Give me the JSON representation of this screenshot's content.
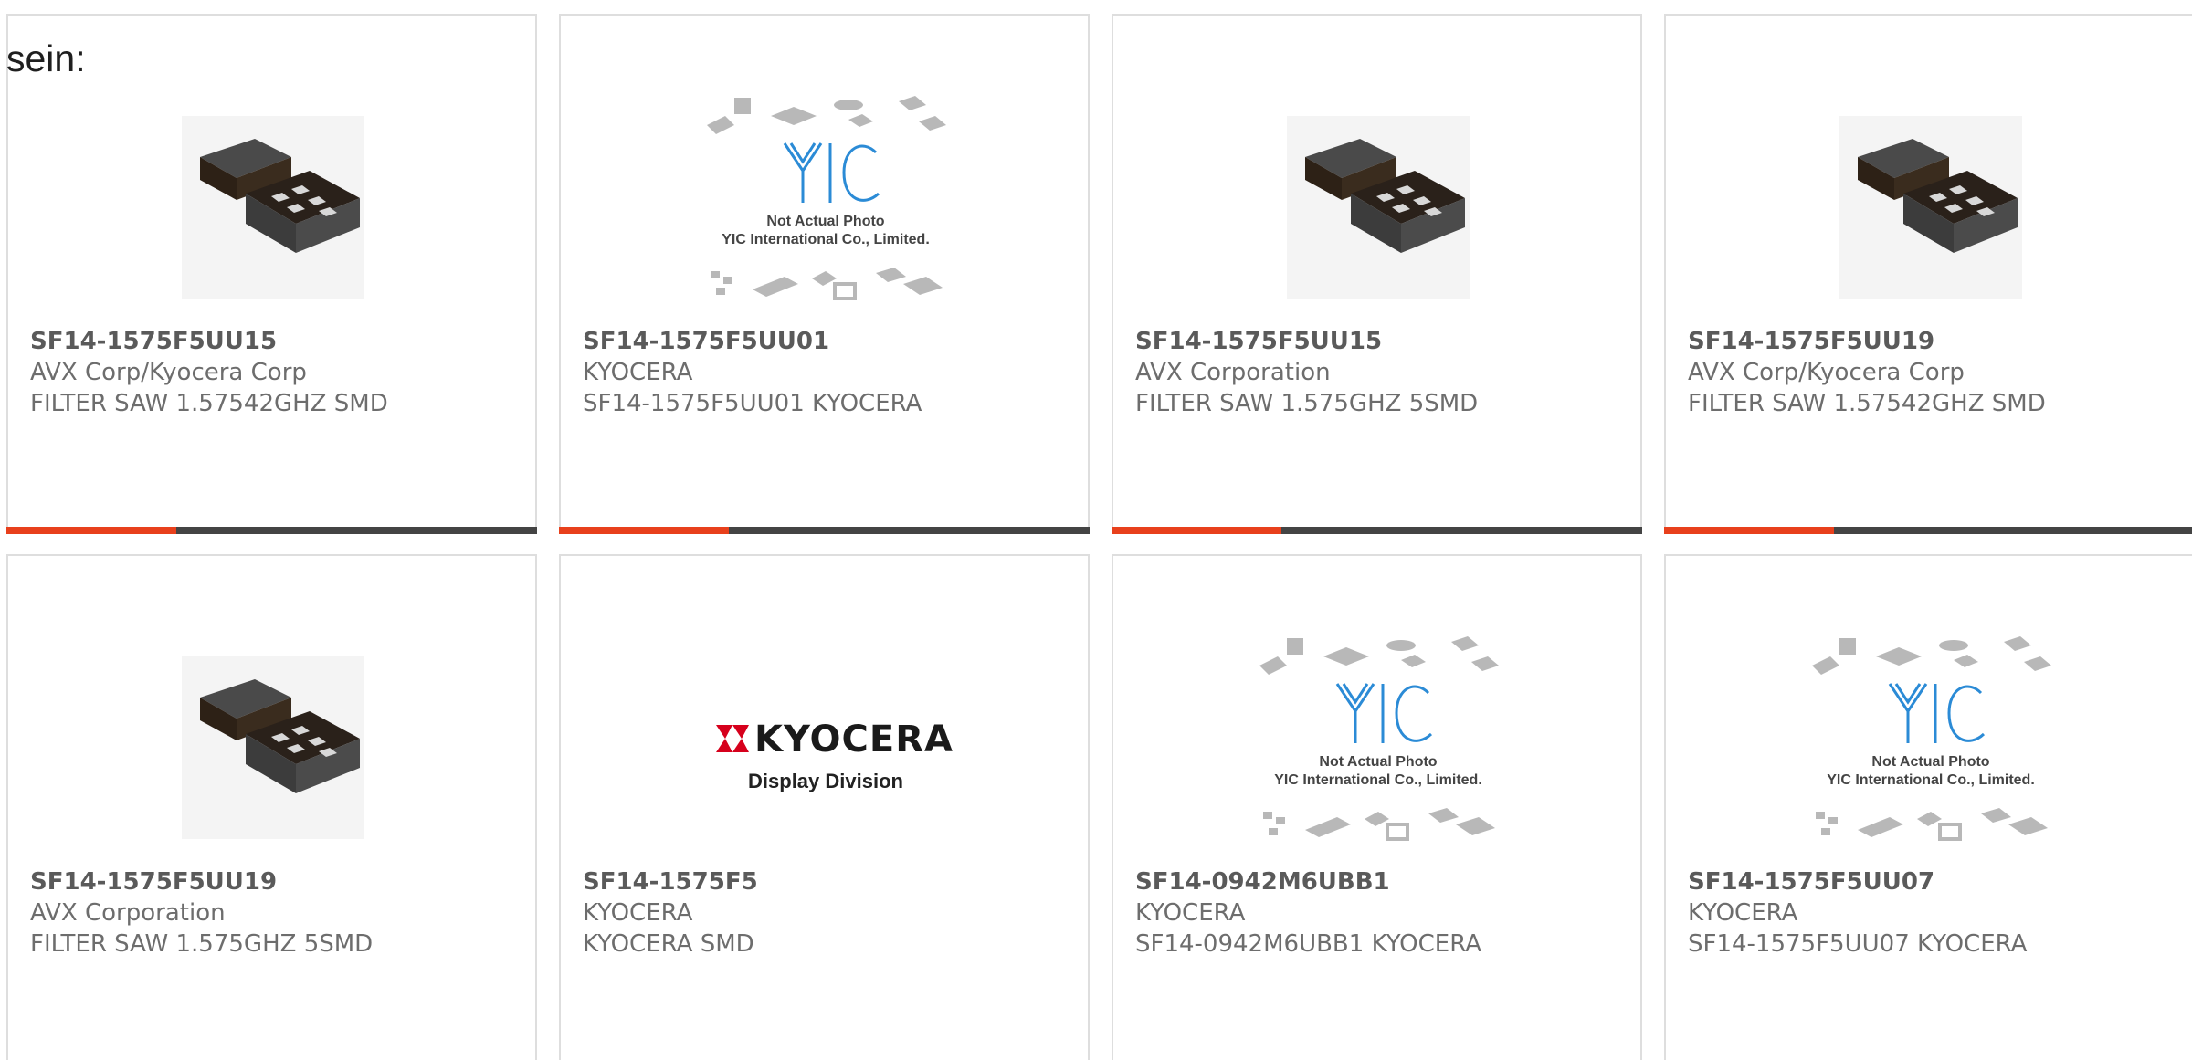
{
  "intro_text": "sein:",
  "colors": {
    "accent": "#e8401c",
    "bar_track": "#444444",
    "card_border": "#dedede",
    "text": "#6d6d6d"
  },
  "products": [
    {
      "part_number": "SF14-1575F5UU15",
      "manufacturer": "AVX Corp/Kyocera Corp",
      "description": "FILTER SAW 1.57542GHZ SMD",
      "image": "saw-filter-chip",
      "progress": 0.32
    },
    {
      "part_number": "SF14-1575F5UU01",
      "manufacturer": "KYOCERA",
      "description": "SF14-1575F5UU01 KYOCERA",
      "image": "yic-placeholder",
      "progress": 0.32,
      "image_text": {
        "line1": "Not Actual Photo",
        "line2": "YIC International Co., Limited."
      }
    },
    {
      "part_number": "SF14-1575F5UU15",
      "manufacturer": "AVX Corporation",
      "description": "FILTER SAW 1.575GHZ 5SMD",
      "image": "saw-filter-chip",
      "progress": 0.32
    },
    {
      "part_number": "SF14-1575F5UU19",
      "manufacturer": "AVX Corp/Kyocera Corp",
      "description": "FILTER SAW 1.57542GHZ SMD",
      "image": "saw-filter-chip",
      "progress": 0.32
    },
    {
      "part_number": "SF14-1575F5UU19",
      "manufacturer": "AVX Corporation",
      "description": "FILTER SAW 1.575GHZ 5SMD",
      "image": "saw-filter-chip"
    },
    {
      "part_number": "SF14-1575F5",
      "manufacturer": "KYOCERA",
      "description": "KYOCERA SMD",
      "image": "kyocera-logo",
      "image_text": {
        "brand": "KYOCERA",
        "division": "Display Division"
      }
    },
    {
      "part_number": "SF14-0942M6UBB1",
      "manufacturer": "KYOCERA",
      "description": "SF14-0942M6UBB1 KYOCERA",
      "image": "yic-placeholder",
      "image_text": {
        "line1": "Not Actual Photo",
        "line2": "YIC International Co., Limited."
      }
    },
    {
      "part_number": "SF14-1575F5UU07",
      "manufacturer": "KYOCERA",
      "description": "SF14-1575F5UU07 KYOCERA",
      "image": "yic-placeholder",
      "image_text": {
        "line1": "Not Actual Photo",
        "line2": "YIC International Co., Limited."
      }
    }
  ]
}
